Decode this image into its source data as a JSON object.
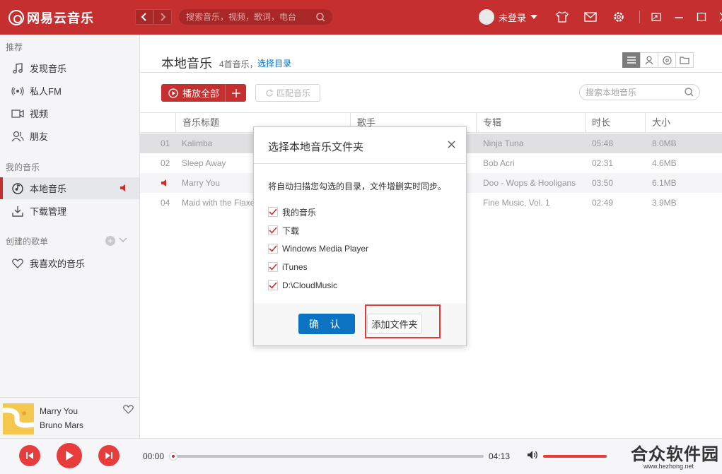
{
  "app": {
    "title": "网易云音乐"
  },
  "search_top": {
    "placeholder": "搜索音乐，视频，歌词，电台"
  },
  "user": {
    "label": "未登录"
  },
  "sidebar": {
    "sec_recommend": "推荐",
    "recommend": [
      {
        "label": "发现音乐",
        "icon": "music-note-icon"
      },
      {
        "label": "私人FM",
        "icon": "radio-icon"
      },
      {
        "label": "视频",
        "icon": "video-icon"
      },
      {
        "label": "朋友",
        "icon": "friends-icon"
      }
    ],
    "sec_my_music": "我的音乐",
    "my_music": [
      {
        "label": "本地音乐",
        "icon": "local-music-icon",
        "active": true
      },
      {
        "label": "下载管理",
        "icon": "download-icon"
      }
    ],
    "sec_playlists": "创建的歌单",
    "playlists": [
      {
        "label": "我喜欢的音乐",
        "icon": "heart-icon"
      }
    ]
  },
  "now_playing": {
    "title": "Marry You",
    "artist": "Bruno Mars"
  },
  "main": {
    "title": "本地音乐",
    "count": "4首音乐，",
    "select_dir": "选择目录",
    "play_all": "播放全部",
    "match": "匹配音乐",
    "search_placeholder": "搜索本地音乐"
  },
  "table": {
    "headers": {
      "title": "音乐标题",
      "artist": "歌手",
      "album": "专辑",
      "duration": "时长",
      "size": "大小"
    },
    "rows": [
      {
        "index": "01",
        "title": "Kalimba",
        "album": "Ninja Tuna",
        "duration": "05:48",
        "size": "8.0MB"
      },
      {
        "index": "02",
        "title": "Sleep Away",
        "album": "Bob Acri",
        "duration": "02:31",
        "size": "4.6MB"
      },
      {
        "index": "",
        "title": "Marry You",
        "album": "Doo - Wops & Hooligans",
        "duration": "03:50",
        "size": "6.1MB",
        "playing": true
      },
      {
        "index": "04",
        "title": "Maid with the Flaxe",
        "album": "Fine Music, Vol. 1",
        "duration": "02:49",
        "size": "3.9MB"
      }
    ]
  },
  "dialog": {
    "title": "选择本地音乐文件夹",
    "description": "将自动扫描您勾选的目录，文件增删实时同步。",
    "folders": [
      {
        "label": "我的音乐",
        "checked": true
      },
      {
        "label": "下载",
        "checked": true
      },
      {
        "label": "Windows Media Player",
        "checked": true
      },
      {
        "label": "iTunes",
        "checked": true
      },
      {
        "label": "D:\\CloudMusic",
        "checked": true
      }
    ],
    "confirm": "确 认",
    "add_folder": "添加文件夹"
  },
  "player": {
    "current_time": "00:00",
    "total_time": "04:13",
    "progress": 0,
    "volume": 1.0
  },
  "watermark": {
    "text": "合众软件园",
    "url": "www.hezhong.net"
  },
  "colors": {
    "brand_red": "#c62f2f",
    "accent_blue": "#0c73c2",
    "highlight_red": "#e23b3b"
  }
}
